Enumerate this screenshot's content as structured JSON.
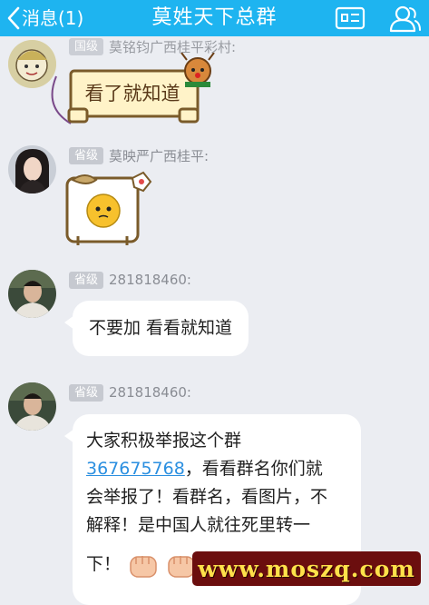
{
  "header": {
    "back_label": "消息(1)",
    "title": "莫姓天下总群"
  },
  "messages": [
    {
      "badge": "国级",
      "sender": "莫铭钧广西桂平彩村:",
      "sticker_text": "看了就知道"
    },
    {
      "badge": "省级",
      "sender": "莫映严广西桂平:"
    },
    {
      "badge": "省级",
      "sender": "281818460:",
      "text": "不要加 看看就知道"
    },
    {
      "badge": "省级",
      "sender": "281818460:",
      "line1": "大家积极举报这个群",
      "link": "367675768",
      "line2_rest": "，看看群名你们就",
      "line3": "会举报了！看群名，看图片，不",
      "line4": "解释！是中国人就往死里转一",
      "line5": "下！"
    }
  ],
  "watermark": "www.moszq.com",
  "colors": {
    "header_bg": "#1eb4f0",
    "page_bg": "#ebedf2",
    "link": "#2b8fe0"
  }
}
